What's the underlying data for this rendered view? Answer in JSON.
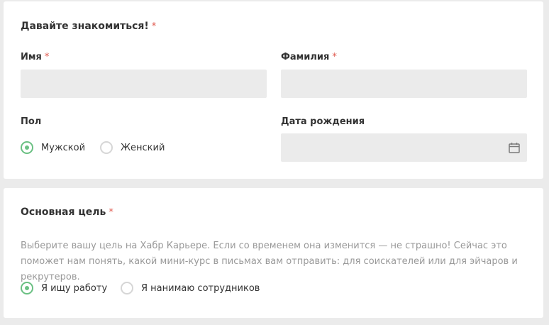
{
  "intro": {
    "title": "Давайте знакомиться!",
    "required_mark": "*",
    "first_name": {
      "label": "Имя",
      "required_mark": "*",
      "value": ""
    },
    "last_name": {
      "label": "Фамилия",
      "required_mark": "*",
      "value": ""
    },
    "gender": {
      "label": "Пол",
      "options": [
        {
          "label": "Мужской",
          "checked": true
        },
        {
          "label": "Женский",
          "checked": false
        }
      ]
    },
    "birth_date": {
      "label": "Дата рождения",
      "value": "",
      "icon": "calendar-icon"
    }
  },
  "goal": {
    "title": "Основная цель",
    "required_mark": "*",
    "hint": "Выберите вашу цель на Хабр Карьере. Если со временем она изменится — не страшно! Сейчас это поможет нам понять, какой мини-курс в письмах вам отправить: для соискателей или для эйчаров и рекрутеров.",
    "options": [
      {
        "label": "Я ищу работу",
        "checked": true
      },
      {
        "label": "Я нанимаю сотрудников",
        "checked": false
      }
    ]
  },
  "colors": {
    "accent_green": "#6bc083",
    "required_red": "#e05a4f",
    "input_bg": "#ebebeb"
  }
}
